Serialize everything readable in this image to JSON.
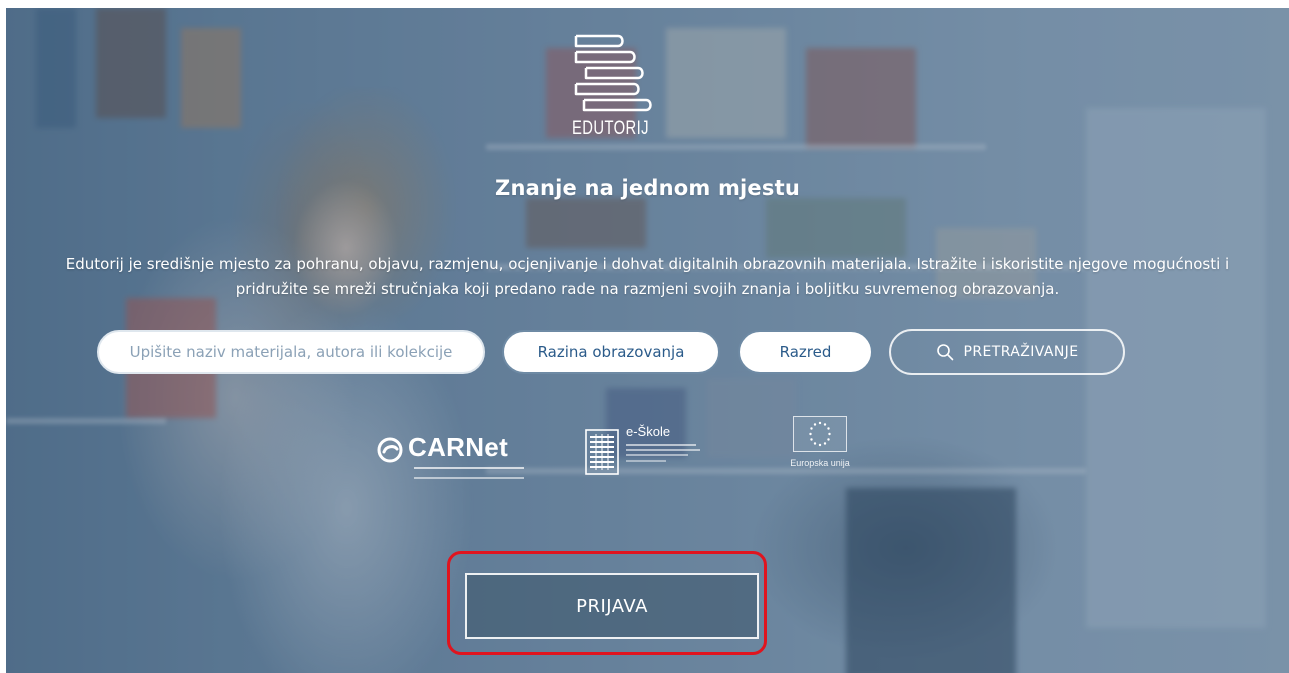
{
  "brand": {
    "name": "EDUTORIJ"
  },
  "hero": {
    "headline": "Znanje na jednom mjestu",
    "intro_line1": "Edutorij je središnje mjesto za pohranu, objavu, razmjenu, ocjenjivanje i dohvat digitalnih obrazovnih materijala. Istražite i iskoristite njegove mogućnosti i",
    "intro_line2": "pridružite se mreži stručnjaka koji predano rade na razmjeni svojih znanja i boljitku suvremenog obrazovanja."
  },
  "search": {
    "placeholder": "Upišite naziv materijala, autora ili kolekcije",
    "value": "",
    "level_label": "Razina obrazovanja",
    "grade_label": "Razred",
    "button_label": "PRETRAŽIVANJE"
  },
  "partners": {
    "carnet": "CARNet",
    "eskole": "e-Škole",
    "eu": "Europska unija"
  },
  "login": {
    "label": "PRIJAVA"
  },
  "colors": {
    "highlight": "#e0141e",
    "pill_text": "#2b5b8a",
    "placeholder": "#8ba1b6"
  },
  "icons": {
    "logo": "book-stack-icon",
    "search": "search-icon",
    "carnet": "carnet-logo-icon",
    "eskole": "abacus-icon",
    "eu": "eu-flag-icon"
  }
}
